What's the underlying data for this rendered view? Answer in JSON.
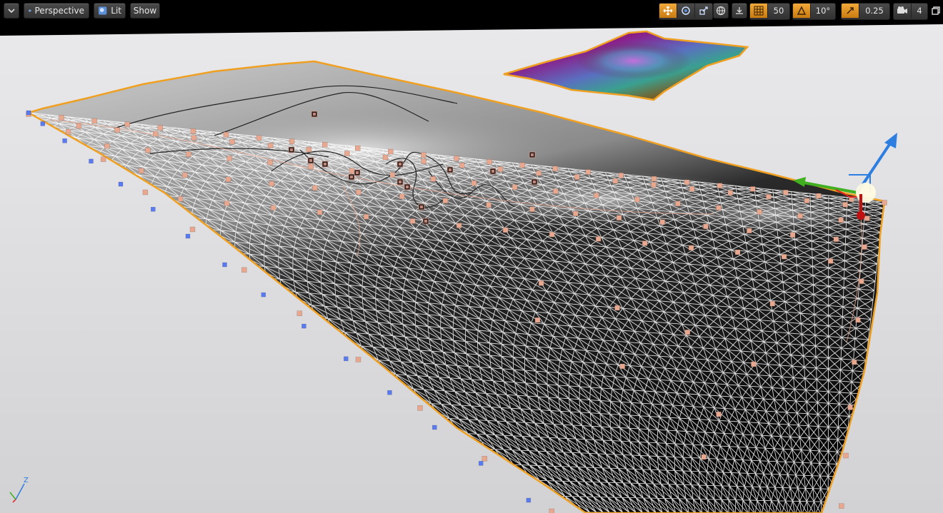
{
  "viewport": {
    "view_mode": "Perspective",
    "lighting_mode": "Lit",
    "show_label": "Show"
  },
  "toolbar_right": {
    "grid_snap_value": "50",
    "rotation_snap_value": "10°",
    "scale_snap_value": "0.25",
    "camera_speed_value": "4"
  },
  "axis_indicator": {
    "z_label": "Z"
  },
  "colors": {
    "viewport_background": "#d6d6d8",
    "selection_outline": "#f0a020",
    "control_point": "#e8a890",
    "edge_control_point": "#5a7af0",
    "gizmo_x": "#e02020",
    "gizmo_y": "#40b020",
    "gizmo_z": "#2e7de0",
    "toolbar_active": "#e8961e"
  }
}
